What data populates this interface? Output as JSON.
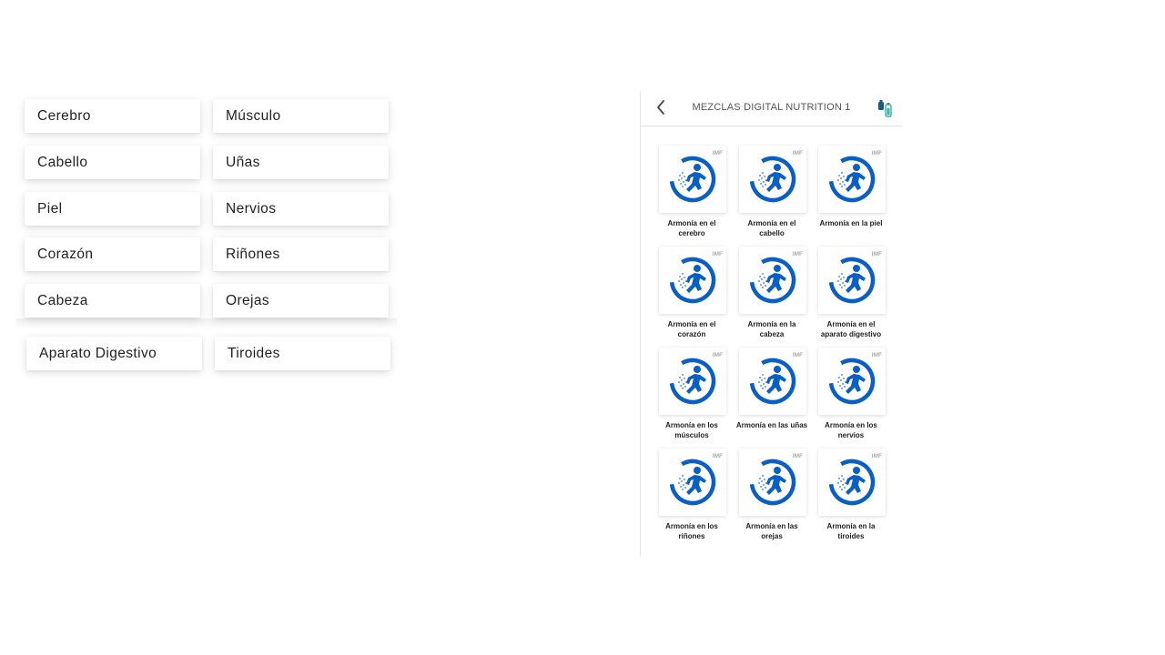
{
  "categories": [
    "Cerebro",
    "Músculo",
    "Cabello",
    "Uñas",
    "Piel",
    "Nervios",
    "Corazón",
    "Riñones",
    "Cabeza",
    "Orejas",
    "Aparato Digestivo",
    "Tiroides"
  ],
  "phone": {
    "title": "MEZCLAS DIGITAL NUTRITION 1",
    "back_icon": "chevron-left-icon",
    "cart_icon": "bottles-icon",
    "tile_badge": "IMF",
    "tiles": [
      {
        "label": "Armonía en el\ncerebro"
      },
      {
        "label": "Armonía en el\ncabello"
      },
      {
        "label": "Armonía en la piel"
      },
      {
        "label": "Armonía en el\ncorazón"
      },
      {
        "label": "Armonía en la\ncabeza"
      },
      {
        "label": "Armonía en el\naparato digestivo"
      },
      {
        "label": "Armonía en los\nmúsculos"
      },
      {
        "label": "Armonía en las uñas"
      },
      {
        "label": "Armonía en los\nnervios"
      },
      {
        "label": "Armonía en los\nriñones"
      },
      {
        "label": "Armonía en las\norejas"
      },
      {
        "label": "Armonía en la\ntiroides"
      }
    ],
    "accent_color": "#0a5fc6"
  }
}
